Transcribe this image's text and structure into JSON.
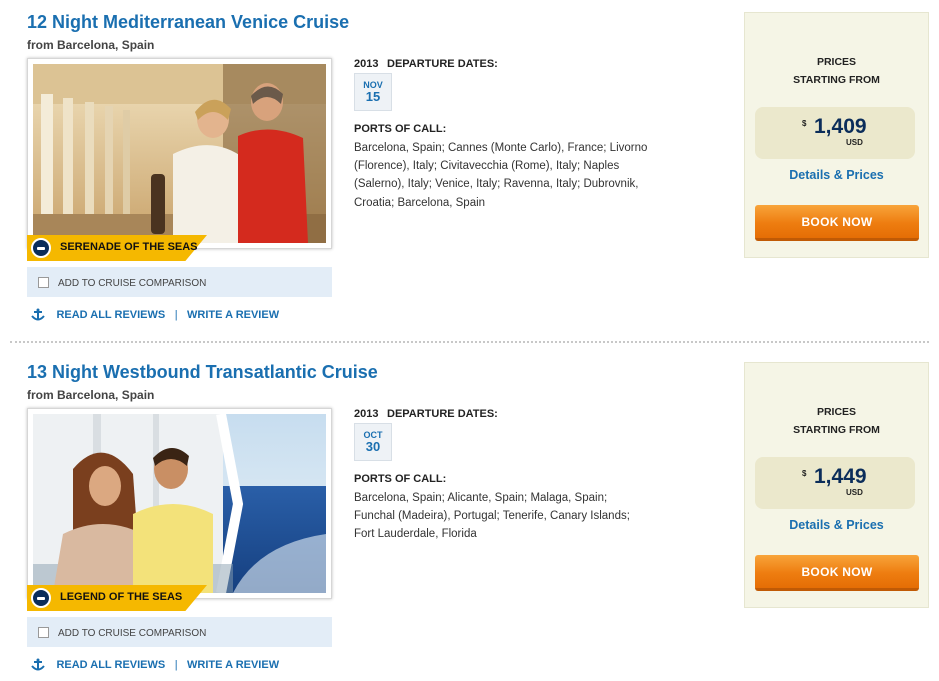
{
  "cruises": [
    {
      "title": "12 Night Mediterranean Venice Cruise",
      "from": "from Barcelona, Spain",
      "ship": "SERENADE OF THE SEAS",
      "compare_label": "ADD TO CRUISE COMPARISON",
      "read_reviews": "READ ALL REVIEWS",
      "separator": "|",
      "write_review": "WRITE A REVIEW",
      "year": "2013",
      "departure_title": "DEPARTURE DATES:",
      "month": "NOV",
      "day": "15",
      "ports_title": "PORTS OF CALL:",
      "ports": "Barcelona, Spain; Cannes (Monte Carlo), France; Livorno (Florence), Italy; Civitavecchia (Rome), Italy; Naples (Salerno), Italy; Venice, Italy; Ravenna, Italy; Dubrovnik, Croatia; Barcelona, Spain",
      "prices_line1": "PRICES",
      "prices_line2": "STARTING FROM",
      "currency_symbol": "$",
      "price": "1,409",
      "currency": "USD",
      "details_label": "Details & Prices",
      "book_label": "BOOK NOW"
    },
    {
      "title": "13 Night Westbound Transatlantic Cruise",
      "from": "from Barcelona, Spain",
      "ship": "LEGEND OF THE SEAS",
      "compare_label": "ADD TO CRUISE COMPARISON",
      "read_reviews": "READ ALL REVIEWS",
      "separator": "|",
      "write_review": "WRITE A REVIEW",
      "year": "2013",
      "departure_title": "DEPARTURE DATES:",
      "month": "OCT",
      "day": "30",
      "ports_title": "PORTS OF CALL:",
      "ports": "Barcelona, Spain; Alicante, Spain; Malaga, Spain; Funchal (Madeira), Portugal; Tenerife, Canary Islands; Fort Lauderdale, Florida",
      "prices_line1": "PRICES",
      "prices_line2": "STARTING FROM",
      "currency_symbol": "$",
      "price": "1,449",
      "currency": "USD",
      "details_label": "Details & Prices",
      "book_label": "BOOK NOW"
    }
  ],
  "colors": {
    "link_blue": "#1a6fb0",
    "navy": "#0b2d5a",
    "banner_yellow": "#f5b800",
    "book_orange": "#ee7d10",
    "price_panel": "#f5f5e6",
    "compare_bg": "#e3edf7"
  }
}
